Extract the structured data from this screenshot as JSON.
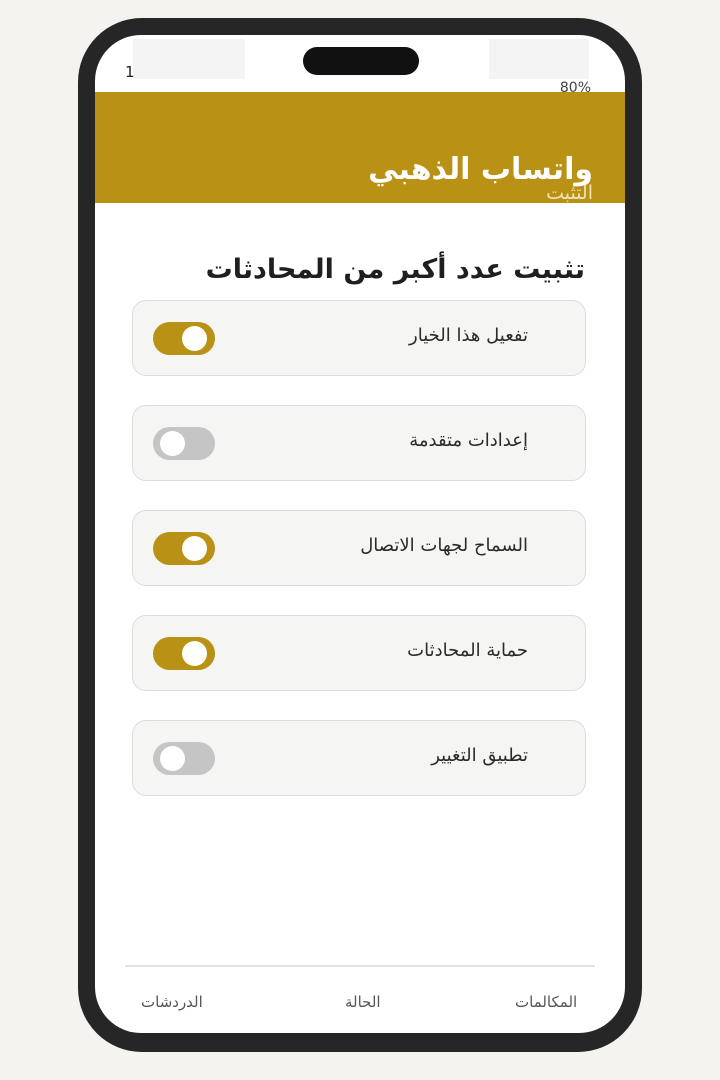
{
  "status_bar": {
    "time_fragment": "1",
    "battery": "80%"
  },
  "header": {
    "title": "واتساب الذهبي",
    "subtitle": "التثبت",
    "accent_color": "#b99114"
  },
  "section": {
    "title": "تثبيت عدد أكبر من المحادثات"
  },
  "options": [
    {
      "label": "تفعيل هذا الخيار",
      "enabled": true
    },
    {
      "label": "إعدادات متقدمة",
      "enabled": false
    },
    {
      "label": "السماح لجهات الاتصال",
      "enabled": true
    },
    {
      "label": "حماية المحادثات",
      "enabled": true
    },
    {
      "label": "تطبيق التغيير",
      "enabled": false
    }
  ],
  "bottom_nav": {
    "chats": "الدردشات",
    "status": "الحالة",
    "calls": "المكالمات"
  }
}
